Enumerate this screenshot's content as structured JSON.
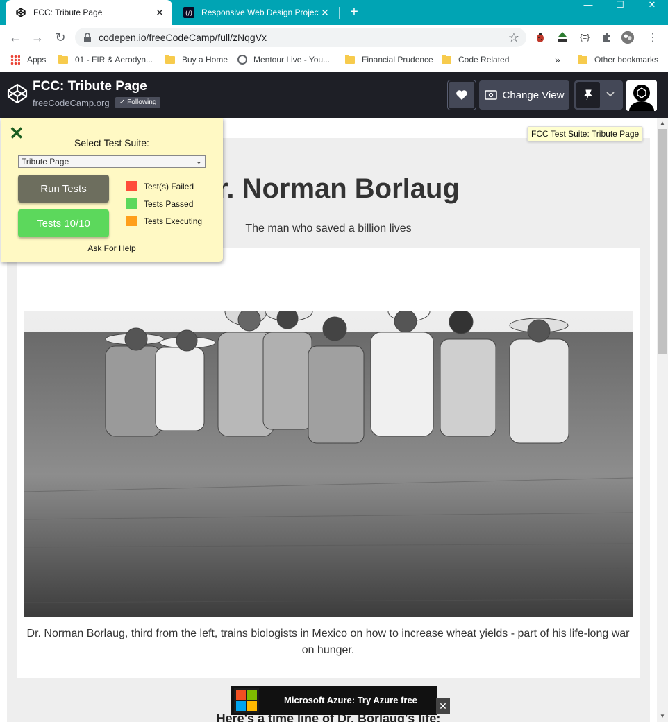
{
  "browser": {
    "tabs": [
      {
        "title": "FCC: Tribute Page",
        "active": true
      },
      {
        "title": "Responsive Web Design Projects",
        "active": false
      }
    ],
    "url": "codepen.io/freeCodeCamp/full/zNqgVx",
    "bookmarks": [
      "Apps",
      "01 - FIR & Aerodyn...",
      "Buy a Home",
      "Mentour Live - You...",
      "Financial Prudence",
      "Code Related",
      "Other bookmarks"
    ],
    "overflow_chevron": "»",
    "accent_color": "#00a4b4"
  },
  "codepen": {
    "pen_title": "FCC: Tribute Page",
    "owner": "freeCodeCamp.org",
    "following_label": "✓ Following",
    "change_view_label": "Change View",
    "header_bg": "#1e1f26"
  },
  "test_suite": {
    "close_glyph": "✕",
    "select_label": "Select Test Suite:",
    "selected_suite": "Tribute Page",
    "run_tests_label": "Run Tests",
    "tests_result_label": "Tests 10/10",
    "legend": [
      {
        "label": "Test(s) Failed",
        "color": "#ff4d3a"
      },
      {
        "label": "Tests Passed",
        "color": "#5cd85c"
      },
      {
        "label": "Tests Executing",
        "color": "#ff9f1a"
      }
    ],
    "help_link": "Ask For Help",
    "tooltip": "FCC Test Suite: Tribute Page"
  },
  "tribute": {
    "title": "Dr. Norman Borlaug",
    "subtitle": "The man who saved a billion lives",
    "image_caption": "Dr. Norman Borlaug, third from the left, trains biologists in Mexico on how to increase wheat yields - part of his life-long war on hunger.",
    "timeline_heading": "Here's a time line of Dr. Borlaug's life:"
  },
  "ad": {
    "text": "Microsoft Azure: Try Azure free",
    "close_glyph": "✕"
  }
}
